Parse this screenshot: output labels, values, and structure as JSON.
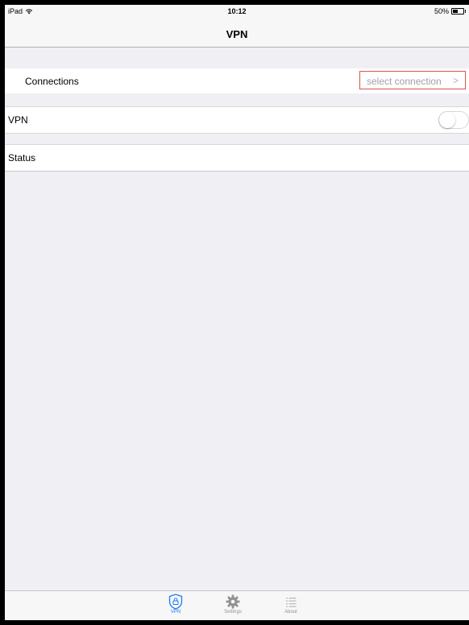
{
  "status_bar": {
    "device": "iPad",
    "time": "10:12",
    "battery": "50%"
  },
  "nav": {
    "title": "VPN"
  },
  "connections": {
    "label": "Connections",
    "value": "select connection",
    "chevron": ">"
  },
  "vpn": {
    "label": "VPN",
    "toggle_on": false
  },
  "status": {
    "label": "Status"
  },
  "tabs": [
    {
      "label": "VPN",
      "icon": "shield-lock-icon",
      "active": true
    },
    {
      "label": "Settings",
      "icon": "gear-icon",
      "active": false
    },
    {
      "label": "About",
      "icon": "list-icon",
      "active": false
    }
  ],
  "colors": {
    "accent": "#1e7cf6",
    "highlight_border": "#e05050",
    "background": "#efeff4"
  }
}
